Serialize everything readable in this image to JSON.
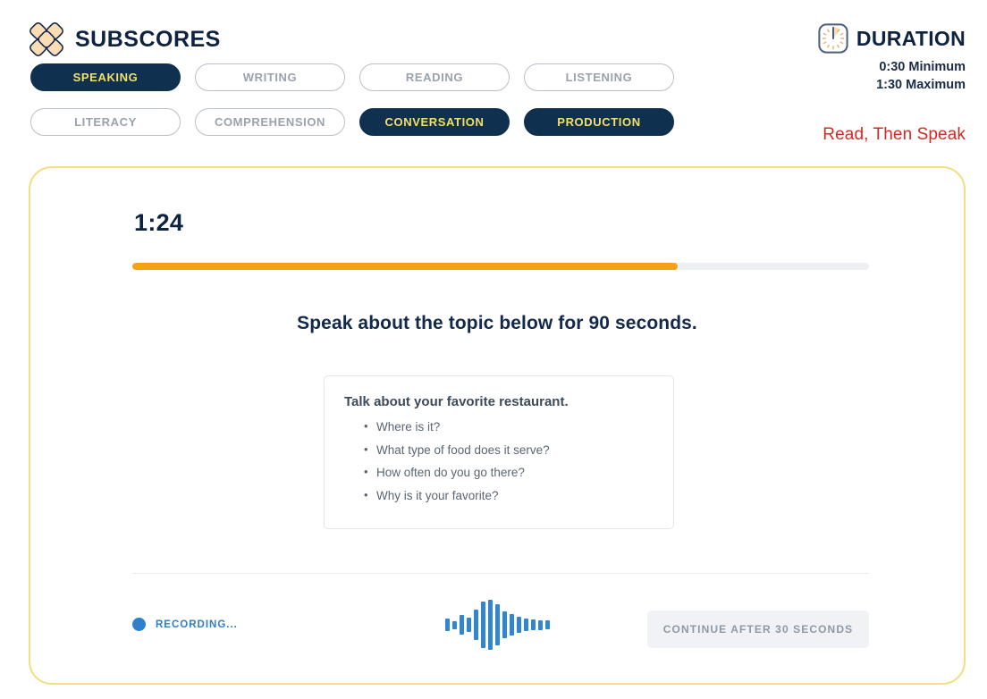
{
  "brand": {
    "title": "SUBSCORES",
    "logo_name": "diamond-cluster-logo"
  },
  "colors": {
    "navy": "#10304f",
    "accent_yellow": "#f2e06a",
    "card_border": "#f4de83",
    "progress_fill": "#f5a316",
    "progress_track": "#edeff2",
    "recording_blue": "#2f80c8",
    "task_type_red": "#d32a22",
    "pill_inactive_text": "#9aa2ae"
  },
  "subscore_tabs": {
    "row1": [
      {
        "label": "SPEAKING",
        "active": true
      },
      {
        "label": "WRITING",
        "active": false
      },
      {
        "label": "READING",
        "active": false
      },
      {
        "label": "LISTENING",
        "active": false
      }
    ],
    "row2": [
      {
        "label": "LITERACY",
        "active": false
      },
      {
        "label": "COMPREHENSION",
        "active": false
      },
      {
        "label": "CONVERSATION",
        "active": true
      },
      {
        "label": "PRODUCTION",
        "active": true
      }
    ]
  },
  "duration": {
    "title": "DURATION",
    "minimum": "0:30 Minimum",
    "maximum": "1:30 Maximum",
    "icon_name": "clock-icon"
  },
  "task_type": "Read, Then Speak",
  "task": {
    "timer": "1:24",
    "progress_percent": 74,
    "heading": "Speak about the topic below for 90 seconds.",
    "prompt": {
      "title": "Talk about your favorite restaurant.",
      "questions": [
        "Where is it?",
        "What type of food does it serve?",
        "How often do you go there?",
        "Why is it your favorite?"
      ]
    }
  },
  "footer": {
    "recording_label": "RECORDING...",
    "continue_label": "CONTINUE AFTER 30 SECONDS",
    "waveform": {
      "icon_name": "audio-waveform-icon",
      "bars": [
        14,
        9,
        22,
        16,
        34,
        52,
        56,
        46,
        30,
        24,
        18,
        14,
        12,
        11,
        10
      ]
    }
  }
}
